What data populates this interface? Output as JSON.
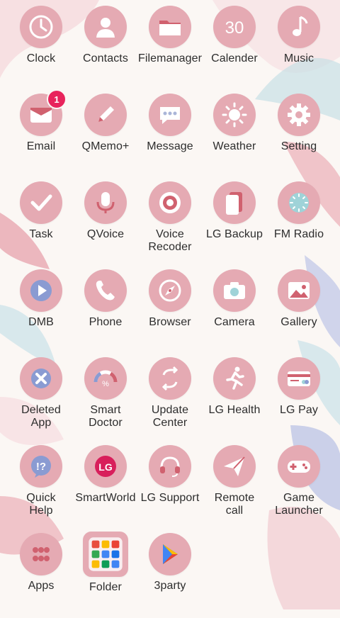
{
  "home": {
    "apps": [
      {
        "id": "clock",
        "label": "Clock",
        "icon": "clock-icon"
      },
      {
        "id": "contacts",
        "label": "Contacts",
        "icon": "contacts-icon"
      },
      {
        "id": "filemanager",
        "label": "Filemanager",
        "icon": "folder-icon"
      },
      {
        "id": "calender",
        "label": "Calender",
        "icon": "calendar-icon",
        "icon_text": "30"
      },
      {
        "id": "music",
        "label": "Music",
        "icon": "music-note-icon"
      },
      {
        "id": "email",
        "label": "Email",
        "icon": "envelope-icon",
        "badge": "1"
      },
      {
        "id": "qmemo",
        "label": "QMemo+",
        "icon": "pencil-icon"
      },
      {
        "id": "message",
        "label": "Message",
        "icon": "chat-bubble-icon"
      },
      {
        "id": "weather",
        "label": "Weather",
        "icon": "sun-icon"
      },
      {
        "id": "setting",
        "label": "Setting",
        "icon": "gear-icon"
      },
      {
        "id": "task",
        "label": "Task",
        "icon": "checkmark-icon"
      },
      {
        "id": "qvoice",
        "label": "QVoice",
        "icon": "microphone-icon"
      },
      {
        "id": "voice-recoder",
        "label": "Voice\nRecoder",
        "icon": "record-icon"
      },
      {
        "id": "lg-backup",
        "label": "LG Backup",
        "icon": "backup-icon"
      },
      {
        "id": "fm-radio",
        "label": "FM Radio",
        "icon": "radio-icon"
      },
      {
        "id": "dmb",
        "label": "DMB",
        "icon": "play-icon"
      },
      {
        "id": "phone",
        "label": "Phone",
        "icon": "phone-icon"
      },
      {
        "id": "browser",
        "label": "Browser",
        "icon": "compass-icon"
      },
      {
        "id": "camera",
        "label": "Camera",
        "icon": "camera-icon"
      },
      {
        "id": "gallery",
        "label": "Gallery",
        "icon": "image-icon"
      },
      {
        "id": "deleted-app",
        "label": "Deleted\nApp",
        "icon": "delete-x-icon"
      },
      {
        "id": "smart-doctor",
        "label": "Smart\nDoctor",
        "icon": "gauge-icon"
      },
      {
        "id": "update-center",
        "label": "Update\nCenter",
        "icon": "refresh-icon"
      },
      {
        "id": "lg-health",
        "label": "LG Health",
        "icon": "running-icon"
      },
      {
        "id": "lg-pay",
        "label": "LG Pay",
        "icon": "credit-card-icon"
      },
      {
        "id": "quick-help",
        "label": "Quick\nHelp",
        "icon": "help-bubble-icon",
        "icon_text": "!?"
      },
      {
        "id": "smartworld",
        "label": "SmartWorld",
        "icon": "lg-logo-icon",
        "icon_text": "LG"
      },
      {
        "id": "lg-support",
        "label": "LG Support",
        "icon": "headset-icon"
      },
      {
        "id": "remote-call",
        "label": "Remote\ncall",
        "icon": "paper-plane-icon"
      },
      {
        "id": "game-launcher",
        "label": "Game\nLauncher",
        "icon": "gamepad-icon"
      },
      {
        "id": "apps",
        "label": "Apps",
        "icon": "apps-dots-icon"
      },
      {
        "id": "folder",
        "label": "Folder",
        "icon": "app-folder-icon"
      },
      {
        "id": "3party",
        "label": "3party",
        "icon": "play-store-icon"
      }
    ]
  },
  "colors": {
    "icon_bg": "#e5aab3",
    "icon_fg": "#ffffff",
    "icon_accent": "#d0616f",
    "badge": "#e8245c",
    "label": "#2d2d2d",
    "background": "#fbf7f4"
  }
}
